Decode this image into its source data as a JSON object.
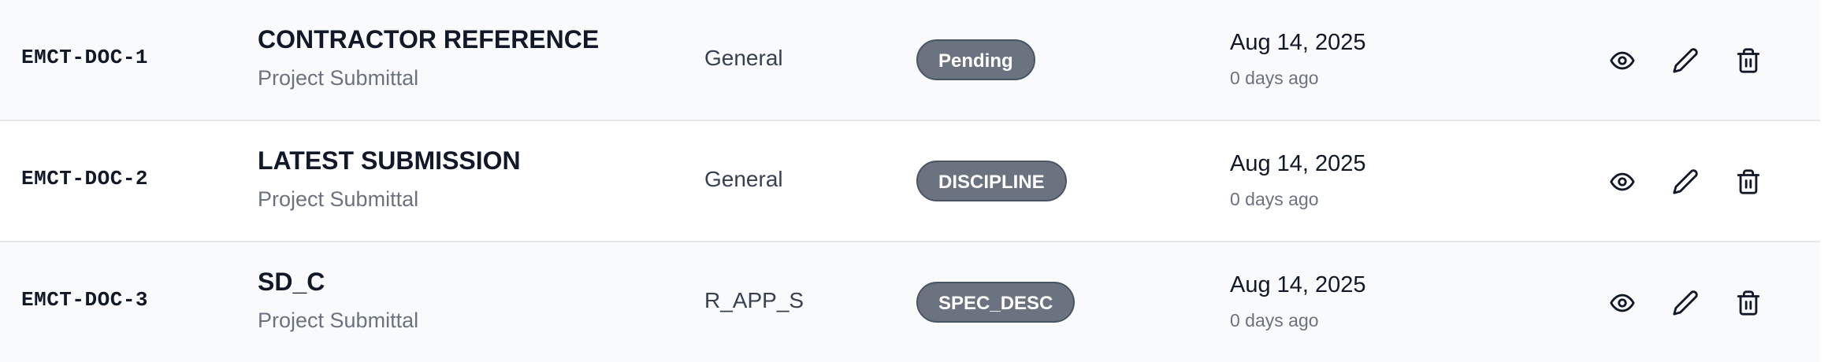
{
  "rows": [
    {
      "id": "EMCT-DOC-1",
      "title": "CONTRACTOR REFERENCE",
      "subtitle": "Project Submittal",
      "category": "General",
      "status": "Pending",
      "date": "Aug 14, 2025",
      "ago": "0 days ago"
    },
    {
      "id": "EMCT-DOC-2",
      "title": "LATEST SUBMISSION",
      "subtitle": "Project Submittal",
      "category": "General",
      "status": "DISCIPLINE",
      "date": "Aug 14, 2025",
      "ago": "0 days ago"
    },
    {
      "id": "EMCT-DOC-3",
      "title": "SD_C",
      "subtitle": "Project Submittal",
      "category": "R_APP_S",
      "status": "SPEC_DESC",
      "date": "Aug 14, 2025",
      "ago": "0 days ago"
    }
  ],
  "actions": {
    "view_icon": "eye-icon",
    "edit_icon": "pencil-icon",
    "delete_icon": "trash-icon"
  },
  "colors": {
    "badge_bg": "#6b7280",
    "row_alt_bg": "#f9fafb",
    "divider": "#e5e7eb"
  }
}
